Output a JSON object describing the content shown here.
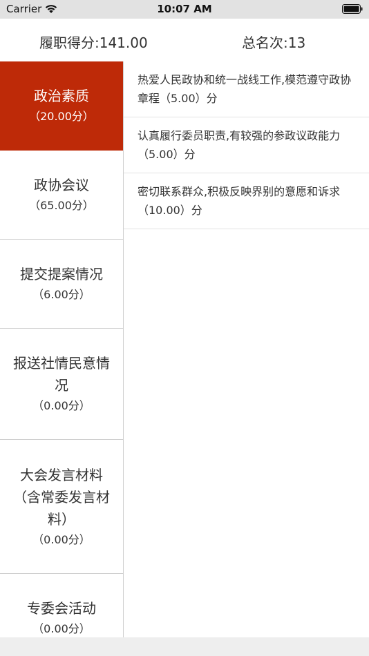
{
  "status_bar": {
    "carrier": "Carrier",
    "time": "10:07 AM"
  },
  "header": {
    "total_score": "履职得分:141.00",
    "rank": "总名次:13"
  },
  "sidebar": {
    "accent_color": "#be2a08",
    "items": [
      {
        "label": "政治素质",
        "score": "（20.00分）",
        "active": true
      },
      {
        "label": "政协会议",
        "score": "（65.00分）",
        "active": false
      },
      {
        "label": "提交提案情况",
        "score": "（6.00分）",
        "active": false
      },
      {
        "label": "报送社情民意情况",
        "score": "（0.00分）",
        "active": false
      },
      {
        "label": "大会发言材料（含常委发言材料）",
        "score": "（0.00分）",
        "active": false
      },
      {
        "label": "专委会活动",
        "score": "（0.00分）",
        "active": false
      }
    ]
  },
  "content": {
    "items": [
      {
        "text": "热爱人民政协和统一战线工作,模范遵守政协章程（5.00）分"
      },
      {
        "text": "认真履行委员职责,有较强的参政议政能力（5.00）分"
      },
      {
        "text": "密切联系群众,积极反映界别的意愿和诉求（10.00）分"
      }
    ]
  }
}
